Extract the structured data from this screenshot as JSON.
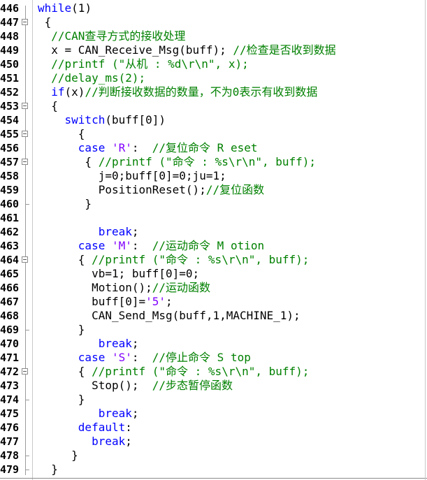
{
  "editor": {
    "colors": {
      "keyword": "#0000ff",
      "comment": "#008000",
      "string": "#8000ff",
      "text": "#000000"
    },
    "lines": [
      {
        "no": "446",
        "fold": "",
        "tokens": [
          {
            "t": "kw",
            "v": "while"
          },
          {
            "t": "nm",
            "v": "(1)"
          }
        ]
      },
      {
        "no": "447",
        "fold": "open",
        "tokens": [
          {
            "t": "nm",
            "v": " {"
          }
        ]
      },
      {
        "no": "448",
        "fold": "",
        "tokens": [
          {
            "t": "nm",
            "v": "  "
          },
          {
            "t": "cm",
            "v": "//CAN查寻方式的接收处理"
          }
        ]
      },
      {
        "no": "449",
        "fold": "",
        "tokens": [
          {
            "t": "nm",
            "v": "  x = CAN_Receive_Msg(buff); "
          },
          {
            "t": "cm",
            "v": "//检查是否收到数据"
          }
        ]
      },
      {
        "no": "450",
        "fold": "",
        "tokens": [
          {
            "t": "nm",
            "v": "  "
          },
          {
            "t": "cm",
            "v": "//printf (\"从机 : %d\\r\\n\", x);"
          }
        ]
      },
      {
        "no": "451",
        "fold": "",
        "tokens": [
          {
            "t": "nm",
            "v": "  "
          },
          {
            "t": "cm",
            "v": "//delay_ms(2);"
          }
        ]
      },
      {
        "no": "452",
        "fold": "",
        "tokens": [
          {
            "t": "nm",
            "v": "  "
          },
          {
            "t": "kw",
            "v": "if"
          },
          {
            "t": "nm",
            "v": "(x)"
          },
          {
            "t": "cm",
            "v": "//判断接收数据的数量，不为0表示有收到数据"
          }
        ]
      },
      {
        "no": "453",
        "fold": "open",
        "tokens": [
          {
            "t": "nm",
            "v": "  {"
          }
        ]
      },
      {
        "no": "454",
        "fold": "",
        "tokens": [
          {
            "t": "nm",
            "v": "    "
          },
          {
            "t": "kw",
            "v": "switch"
          },
          {
            "t": "nm",
            "v": "(buff[0])"
          }
        ]
      },
      {
        "no": "455",
        "fold": "open",
        "tokens": [
          {
            "t": "nm",
            "v": "      {"
          }
        ]
      },
      {
        "no": "456",
        "fold": "",
        "tokens": [
          {
            "t": "nm",
            "v": "      "
          },
          {
            "t": "kw",
            "v": "case"
          },
          {
            "t": "nm",
            "v": " "
          },
          {
            "t": "st",
            "v": "'R'"
          },
          {
            "t": "nm",
            "v": ":  "
          },
          {
            "t": "cm",
            "v": "//复位命令 R eset"
          }
        ]
      },
      {
        "no": "457",
        "fold": "open",
        "tokens": [
          {
            "t": "nm",
            "v": "       { "
          },
          {
            "t": "cm",
            "v": "//printf (\"命令 : %s\\r\\n\", buff);"
          }
        ]
      },
      {
        "no": "458",
        "fold": "",
        "tokens": [
          {
            "t": "nm",
            "v": "         j=0;buff[0]=0;ju=1;"
          }
        ]
      },
      {
        "no": "459",
        "fold": "",
        "tokens": [
          {
            "t": "nm",
            "v": "         PositionReset();"
          },
          {
            "t": "cm",
            "v": "//复位函数"
          }
        ]
      },
      {
        "no": "460",
        "fold": "end",
        "tokens": [
          {
            "t": "nm",
            "v": "       }"
          }
        ]
      },
      {
        "no": "461",
        "fold": "",
        "tokens": []
      },
      {
        "no": "462",
        "fold": "",
        "tokens": [
          {
            "t": "nm",
            "v": "         "
          },
          {
            "t": "kw",
            "v": "break"
          },
          {
            "t": "nm",
            "v": ";"
          }
        ]
      },
      {
        "no": "463",
        "fold": "",
        "tokens": [
          {
            "t": "nm",
            "v": "      "
          },
          {
            "t": "kw",
            "v": "case"
          },
          {
            "t": "nm",
            "v": " "
          },
          {
            "t": "st",
            "v": "'M'"
          },
          {
            "t": "nm",
            "v": ":  "
          },
          {
            "t": "cm",
            "v": "//运动命令 M otion"
          }
        ]
      },
      {
        "no": "464",
        "fold": "open",
        "tokens": [
          {
            "t": "nm",
            "v": "      { "
          },
          {
            "t": "cm",
            "v": "//printf (\"命令 : %s\\r\\n\", buff);"
          }
        ]
      },
      {
        "no": "465",
        "fold": "",
        "tokens": [
          {
            "t": "nm",
            "v": "        vb=1; buff[0]=0;"
          }
        ]
      },
      {
        "no": "466",
        "fold": "",
        "tokens": [
          {
            "t": "nm",
            "v": "        Motion();"
          },
          {
            "t": "cm",
            "v": "//运动函数"
          }
        ]
      },
      {
        "no": "467",
        "fold": "",
        "tokens": [
          {
            "t": "nm",
            "v": "        buff[0]="
          },
          {
            "t": "st",
            "v": "'5'"
          },
          {
            "t": "nm",
            "v": ";"
          }
        ]
      },
      {
        "no": "468",
        "fold": "",
        "tokens": [
          {
            "t": "nm",
            "v": "        CAN_Send_Msg(buff,1,MACHINE_1);"
          }
        ]
      },
      {
        "no": "469",
        "fold": "end",
        "tokens": [
          {
            "t": "nm",
            "v": "      }"
          }
        ]
      },
      {
        "no": "470",
        "fold": "",
        "tokens": [
          {
            "t": "nm",
            "v": "         "
          },
          {
            "t": "kw",
            "v": "break"
          },
          {
            "t": "nm",
            "v": ";"
          }
        ]
      },
      {
        "no": "471",
        "fold": "",
        "tokens": [
          {
            "t": "nm",
            "v": "      "
          },
          {
            "t": "kw",
            "v": "case"
          },
          {
            "t": "nm",
            "v": " "
          },
          {
            "t": "st",
            "v": "'S'"
          },
          {
            "t": "nm",
            "v": ":  "
          },
          {
            "t": "cm",
            "v": "//停止命令 S top"
          }
        ]
      },
      {
        "no": "472",
        "fold": "open",
        "tokens": [
          {
            "t": "nm",
            "v": "      { "
          },
          {
            "t": "cm",
            "v": "//printf (\"命令 : %s\\r\\n\", buff);"
          }
        ]
      },
      {
        "no": "473",
        "fold": "",
        "tokens": [
          {
            "t": "nm",
            "v": "        Stop();  "
          },
          {
            "t": "cm",
            "v": "//步态暂停函数"
          }
        ]
      },
      {
        "no": "474",
        "fold": "end",
        "tokens": [
          {
            "t": "nm",
            "v": "      }"
          }
        ]
      },
      {
        "no": "475",
        "fold": "",
        "tokens": [
          {
            "t": "nm",
            "v": "         "
          },
          {
            "t": "kw",
            "v": "break"
          },
          {
            "t": "nm",
            "v": ";"
          }
        ]
      },
      {
        "no": "476",
        "fold": "",
        "tokens": [
          {
            "t": "nm",
            "v": "      "
          },
          {
            "t": "kw",
            "v": "default"
          },
          {
            "t": "nm",
            "v": ":"
          }
        ]
      },
      {
        "no": "477",
        "fold": "",
        "tokens": [
          {
            "t": "nm",
            "v": "        "
          },
          {
            "t": "kw",
            "v": "break"
          },
          {
            "t": "nm",
            "v": ";"
          }
        ]
      },
      {
        "no": "478",
        "fold": "end",
        "tokens": [
          {
            "t": "nm",
            "v": "     }"
          }
        ]
      },
      {
        "no": "479",
        "fold": "end",
        "tokens": [
          {
            "t": "nm",
            "v": "  }"
          }
        ]
      }
    ]
  }
}
